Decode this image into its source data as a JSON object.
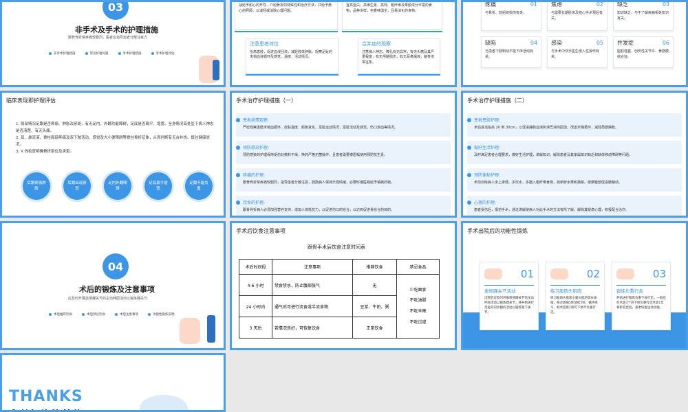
{
  "s1": {
    "num": "03",
    "title": "非手术及手术的护理措施",
    "sub": "跟骨骨折常疼痛较剧烈，医者应指导患者分散注意力",
    "bullets": [
      "非手术护理措施",
      "常见护理问题",
      "手术护理措施",
      "手术护理评估"
    ]
  },
  "s2": {
    "top_left": "战给予耐心的开导，介绍骨折的特殊性和治疗方法，并给予悉心的照顾，以减轻或消除心理问题。",
    "top_right": "宜高蛋白、高维生素、高钙、粗纤维及果胶成分丰富的食物，品种多样，色香味俱全，且易消化的食物。",
    "c3": {
      "title": "注意患者体位",
      "body": "抬高患肢，促进血液回流，减轻肢体肿胀。观察足趾的末梢血液循环及感觉、温度、活动情况。"
    },
    "c4": {
      "title": "合并症的观察",
      "body": "注意病人神志、瞳孔有无异常，有无头痛及其严重程度，有无颅脑损伤，有无耳鼻漏液，脑脊液等征象。"
    }
  },
  "s3": {
    "cards": [
      {
        "t": "疼痛",
        "n": "01",
        "b": "与骨折、软组织损伤有关。"
      },
      {
        "t": "焦虑",
        "n": "02",
        "b": "与需要长期卧床及担心手术预后有关。"
      },
      {
        "t": "缺乏",
        "n": "03",
        "b": "知识缺乏，与不了解疾病相关知识有关。"
      },
      {
        "t": "缺陷",
        "n": "04",
        "b": "与患者下肢制动不能下床活动有关。"
      },
      {
        "t": "感染",
        "n": "05",
        "b": "与手术中非手医生侵入性操作有关。"
      },
      {
        "t": "并发症",
        "n": "06",
        "b": "脂肪栓塞、创伤性关节炎、骨筋膜综合征。"
      }
    ]
  },
  "s4": {
    "header": "临床表现即护理评估",
    "items": [
      "1. 局部情况足跟是否疼痛、肿胀及瘀斑，有无足内、外翻功能障碍，足底是否扁平、增宽。全身情况高处坠下病人神志是否清楚、有无头痛。",
      "2. 耳、鼻流液，脊柱局部疼痛及双下肢活动、感觉及大小便障碍等脊柱骨折征象，从而判断有无合并伤。既往健康状况。",
      "3. X 线检查明确骨折部位及类型。"
    ],
    "circles": [
      "后跟疼痛肿胀",
      "后跟出现瘀斑",
      "足内外翻障碍",
      "足底扁平增宽",
      "足跟不能负重"
    ]
  },
  "s5": {
    "header": "手术治疗护理措施（一）",
    "rows": [
      {
        "t": "患者病情观察:",
        "b": "严密观察患肢末梢血循环、皮肤温度、颜色变化、足趾运动情况，足趾活动及感觉，伤口渗血等情况。"
      },
      {
        "t": "预防感染护理:",
        "b": "预防感染的护理保持受伤处敷料干燥，换药严格无菌操作，且患者需要遵医嘱使用预防抗生素。"
      },
      {
        "t": "疼痛的护理:",
        "b": "跟骨骨折常疼痛较剧烈，指导患者分散注意，鼓励病人保持乐观情绪，必要时遵医嘱给予镇痛药物。"
      },
      {
        "t": "饮食的护理:",
        "b": "跟骨骨折病人必须加强营养支持，增加人体抵抗力，以促进伤口的愈合，以达到促进骨愈合的目的。"
      }
    ]
  },
  "s6": {
    "header": "手术治疗护理措施（二）",
    "rows": [
      {
        "t": "患者患肢护理:",
        "b": "术后进当抬高 20 到 30cm，以促进静脉血液和淋巴液的回流，改善末梢循环，减轻局部肿胀。"
      },
      {
        "t": "做好生活护理:",
        "b": "及时满足患者合理要求，做好生活护理，讲解知识，解除患者及其家属知识缺乏和缺体移动障碍等问题。"
      },
      {
        "t": "预防便秘护理:",
        "b": "术前训练病人床上排便。多饮水，多摄入粗纤维食物，如新鲜水果和蔬菜。按摩腹部促进肠蠕动。"
      },
      {
        "t": "心理的护理:",
        "b": "患者受伤后，惧怕手术，通过讲解使病人对此手术的方法有所了解，解除其疑虑心理，积极配合治疗。"
      }
    ]
  },
  "s7": {
    "num": "04",
    "title": "术后的锻炼及注意事项",
    "sub": "应及时开展患侧踝关节的主动伸屈活动以锻炼踝关节",
    "bullets": [
      "术后推荐饮食",
      "术后禁忌饮食",
      "术后注意事项",
      "功能性锻炼说明"
    ]
  },
  "s8": {
    "header": "手术后饮食注意事项",
    "table_title": "跟骨手术后饮食注意时间表",
    "cols": [
      "术后时间段",
      "注意事项",
      "推荐饮食",
      "禁忌食品"
    ],
    "rows": [
      [
        "4-6 小时",
        "禁食禁水，防止腹部胀气",
        "无"
      ],
      [
        "24 小时内",
        "通气后可进行流食或半流食物",
        "豆浆、牛奶、粥"
      ],
      [
        "3 天后",
        "若情况良好，可恢复饮食",
        "正常饮食"
      ]
    ],
    "avoid": [
      "少吃面食",
      "不吃油腻",
      "不吃辛辣",
      "不吃过咸"
    ]
  },
  "s9": {
    "header": "手术出院后的功能性锻炼",
    "cards": [
      {
        "n": "01",
        "t": "患侧踝关节活动",
        "b": "出院后应及时开展患侧踝关节的主动伸屈活动以锻炼踝关节，并开始进行足趾的内外翻的活动以锻炼距下关节。"
      },
      {
        "n": "02",
        "t": "练习股四头肌肉",
        "b": "练习股四头肌和小腿头肌的等长收缩，每次收缩5秒放松5秒，循环练习，如术后第2周可下地不负重行走。"
      },
      {
        "n": "03",
        "t": "锻炼负重行走",
        "b": "开始进行锻炼负重下床行走，一般应在术后3个月下地负重行走术后1年骨折愈合后，基本恢复运动功能。"
      }
    ]
  },
  "s10": {
    "thanks": "THANKS",
    "cn": "感谢各位的莅临"
  }
}
